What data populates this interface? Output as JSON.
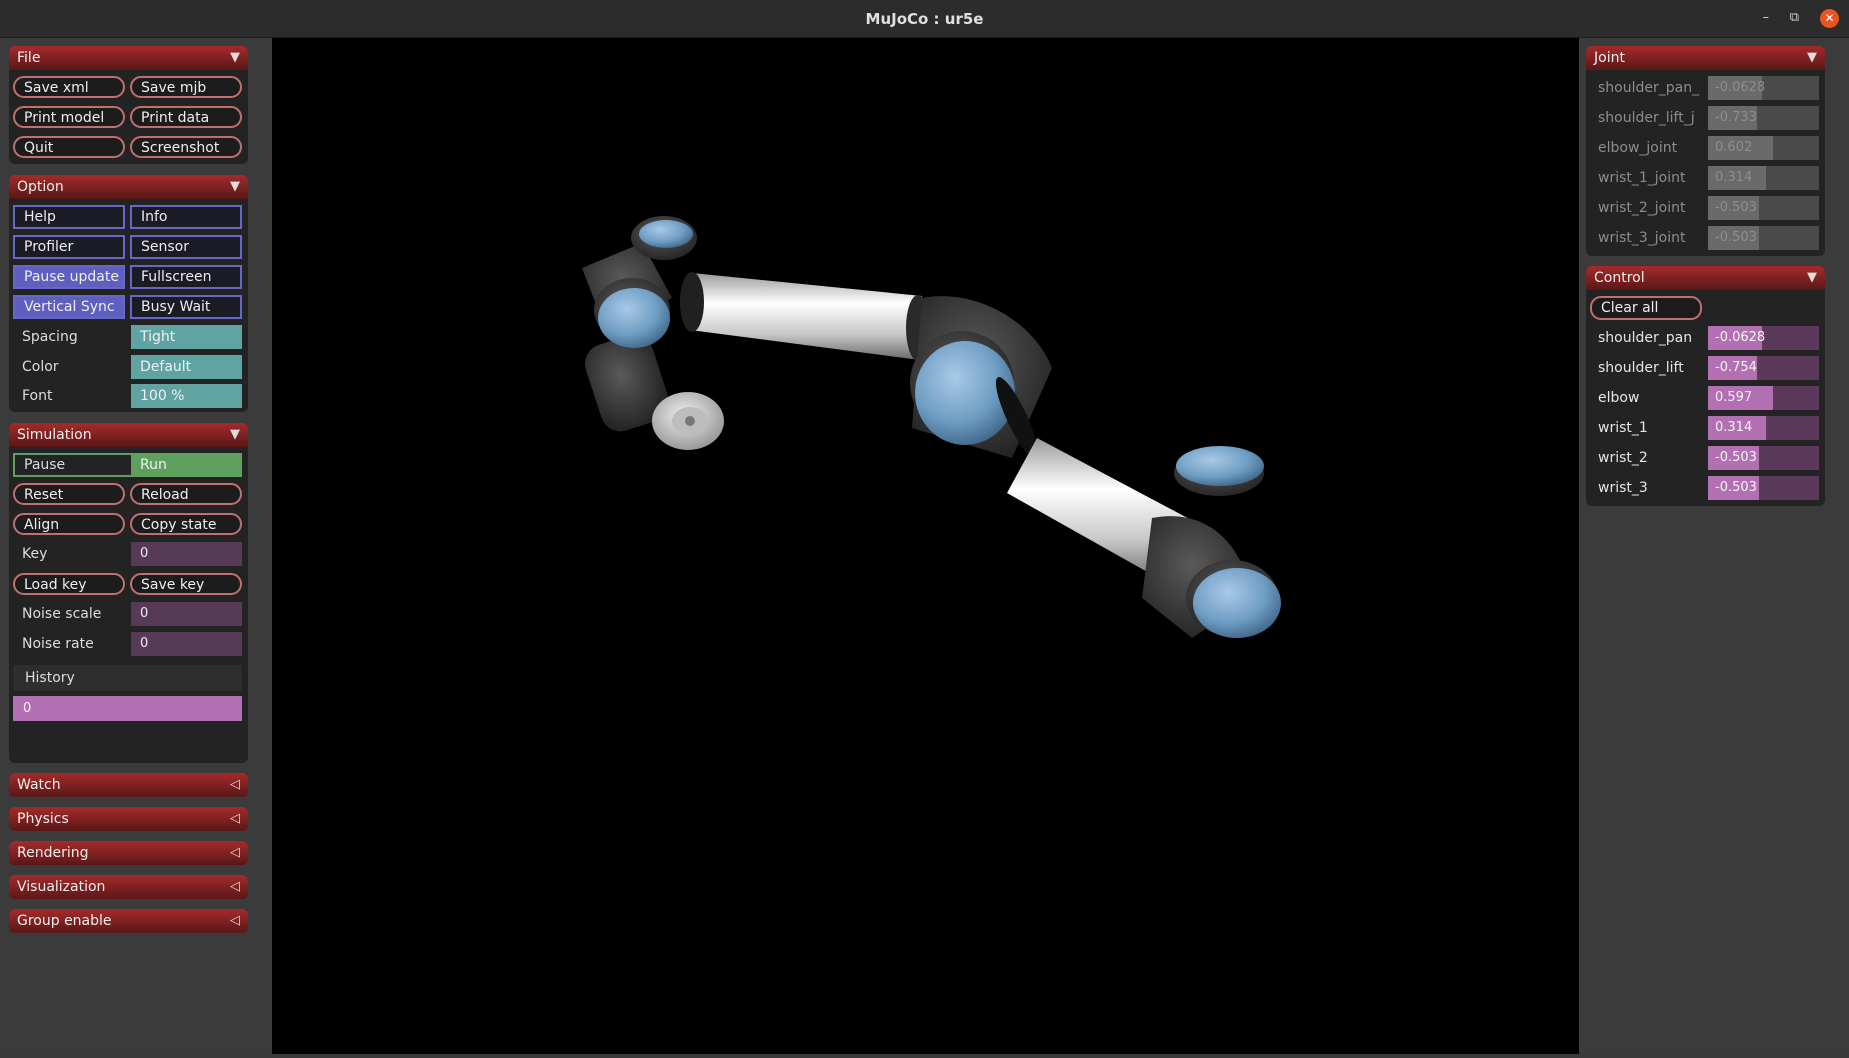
{
  "window": {
    "title": "MuJoCo : ur5e"
  },
  "file": {
    "header": "File",
    "buttons": [
      "Save xml",
      "Save mjb",
      "Print model",
      "Print data",
      "Quit",
      "Screenshot"
    ]
  },
  "option": {
    "header": "Option",
    "toggles": [
      {
        "label": "Help",
        "on": false
      },
      {
        "label": "Info",
        "on": false
      },
      {
        "label": "Profiler",
        "on": false
      },
      {
        "label": "Sensor",
        "on": false
      },
      {
        "label": "Pause update",
        "on": true
      },
      {
        "label": "Fullscreen",
        "on": false
      },
      {
        "label": "Vertical Sync",
        "on": true
      },
      {
        "label": "Busy Wait",
        "on": false
      }
    ],
    "spacing_label": "Spacing",
    "spacing_value": "Tight",
    "color_label": "Color",
    "color_value": "Default",
    "font_label": "Font",
    "font_value": "100 %"
  },
  "simulation": {
    "header": "Simulation",
    "pause_label": "Pause",
    "run_label": "Run",
    "reset": "Reset",
    "reload": "Reload",
    "align": "Align",
    "copy_state": "Copy state",
    "key_label": "Key",
    "key_value": "0",
    "load_key": "Load key",
    "save_key": "Save key",
    "noise_scale_label": "Noise scale",
    "noise_scale_value": "0",
    "noise_rate_label": "Noise rate",
    "noise_rate_value": "0",
    "history_label": "History",
    "history_value": "0"
  },
  "collapsed_sections": [
    "Watch",
    "Physics",
    "Rendering",
    "Visualization",
    "Group enable"
  ],
  "joint": {
    "header": "Joint",
    "rows": [
      {
        "name": "shoulder_pan_",
        "value": "-0.0628",
        "level": 0.49
      },
      {
        "name": "shoulder_lift_j",
        "value": "-0.733",
        "level": 0.44
      },
      {
        "name": "elbow_joint",
        "value": "0.602",
        "level": 0.59
      },
      {
        "name": "wrist_1_joint",
        "value": "0.314",
        "level": 0.52
      },
      {
        "name": "wrist_2_joint",
        "value": "-0.503",
        "level": 0.46
      },
      {
        "name": "wrist_3_joint",
        "value": "-0.503",
        "level": 0.46
      }
    ]
  },
  "control": {
    "header": "Control",
    "clear_all": "Clear all",
    "rows": [
      {
        "name": "shoulder_pan",
        "value": "-0.0628",
        "level": 0.49
      },
      {
        "name": "shoulder_lift",
        "value": "-0.754",
        "level": 0.44
      },
      {
        "name": "elbow",
        "value": "0.597",
        "level": 0.59
      },
      {
        "name": "wrist_1",
        "value": "0.314",
        "level": 0.52
      },
      {
        "name": "wrist_2",
        "value": "-0.503",
        "level": 0.46
      },
      {
        "name": "wrist_3",
        "value": "-0.503",
        "level": 0.46
      }
    ]
  },
  "colors": {
    "section_header": "#a52b2b",
    "option_on": "#5f5fbf",
    "teal": "#5fa3a3",
    "run_green": "#5fa05f",
    "control_fill": "#b26fb2",
    "robot_blue": "#6f9ec4"
  }
}
